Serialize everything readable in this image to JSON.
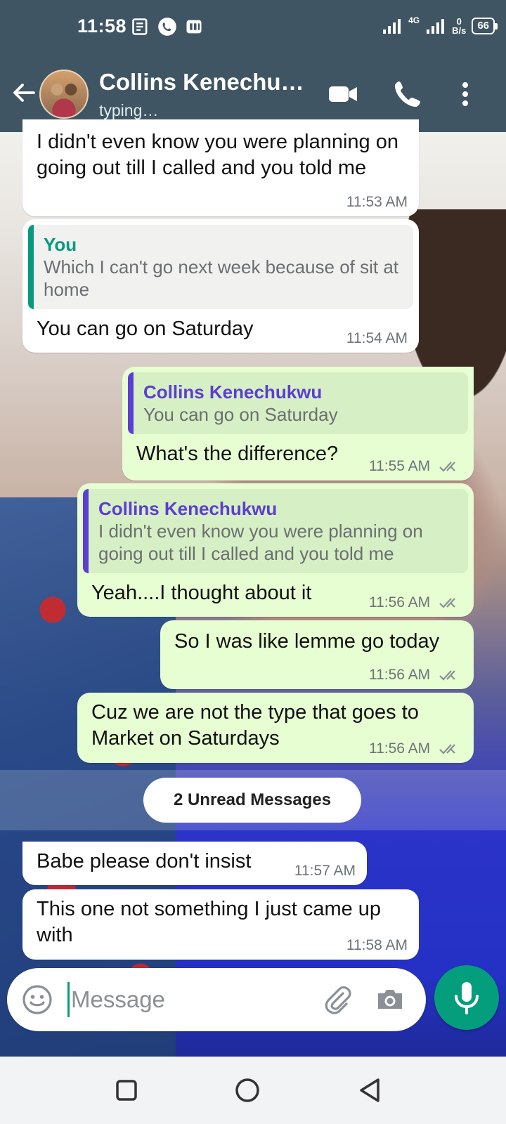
{
  "status_bar": {
    "time": "11:58",
    "network": "4G",
    "data_speed": "0",
    "data_speed_unit": "B/s",
    "battery": "66"
  },
  "header": {
    "contact_name": "Collins Kenechuk…",
    "status": "typing…"
  },
  "messages": [
    {
      "direction": "in",
      "text": "I didn't even know you were planning on going out till I called and you told me",
      "time": "11:53 AM"
    },
    {
      "direction": "in",
      "quote": {
        "author": "You",
        "text": "Which I can't go next week because of sit at home"
      },
      "text": "You can go on Saturday",
      "time": "11:54 AM"
    },
    {
      "direction": "out",
      "quote": {
        "author": "Collins Kenechukwu",
        "text": "You can go on Saturday"
      },
      "text": "What's the difference?",
      "time": "11:55 AM",
      "read": true
    },
    {
      "direction": "out",
      "quote": {
        "author": "Collins Kenechukwu",
        "text": "I didn't even know you were planning on going out till I called and you told me"
      },
      "text": "Yeah....I thought about it",
      "time": "11:56 AM",
      "read": true
    },
    {
      "direction": "out",
      "text": "So I was like lemme go today",
      "time": "11:56 AM",
      "read": true
    },
    {
      "direction": "out",
      "text": "Cuz we are not the type that goes to Market on Saturdays",
      "time": "11:56 AM",
      "read": true
    },
    {
      "direction": "in",
      "text": "Babe please don't insist",
      "time": "11:57 AM"
    },
    {
      "direction": "in",
      "text": "This one not something I just came up with",
      "time": "11:58 AM"
    }
  ],
  "unread_banner": "2 Unread Messages",
  "composer": {
    "placeholder": "Message"
  },
  "colors": {
    "header_bg": "#3f5563",
    "outgoing_bubble": "#e7fdd2",
    "incoming_bubble": "#ffffff",
    "accent": "#059e7d",
    "quote_you": "#079a7e",
    "quote_collins": "#5b3ed2"
  },
  "icons": {
    "back": "arrow-left-icon",
    "video": "video-camera-icon",
    "call": "phone-icon",
    "menu": "more-vertical-icon",
    "emoji": "emoji-icon",
    "attach": "paperclip-icon",
    "camera": "camera-icon",
    "mic": "microphone-icon"
  }
}
